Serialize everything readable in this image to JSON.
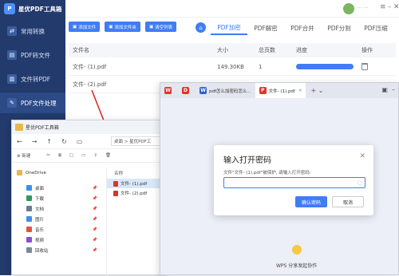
{
  "app": {
    "title": "星优PDF工具箱",
    "logo_text": "PDF",
    "sidebar_items": [
      {
        "label": "常用转换",
        "icon": "convert-icon"
      },
      {
        "label": "PDF转文件",
        "icon": "pdf-to-file-icon"
      },
      {
        "label": "文件转PDF",
        "icon": "file-to-pdf-icon"
      },
      {
        "label": "PDF文件处理",
        "icon": "pdf-process-icon"
      }
    ],
    "user_text": "··· ···",
    "buttons": [
      "添加文件",
      "添加文件夹",
      "清空列表"
    ],
    "tabs": [
      "PDF加密",
      "PDF解密",
      "PDF合并",
      "PDF分割",
      "PDF压缩"
    ],
    "active_tab": "PDF加密",
    "table": {
      "headers": [
        "文件名",
        "大小",
        "总页数",
        "进度",
        "操作"
      ],
      "rows": [
        {
          "name": "文件- (1).pdf",
          "size": "149.30KB",
          "pages": "1",
          "progress": 1.0
        },
        {
          "name": "文件- (2).pdf",
          "size": "",
          "pages": "",
          "progress": 0
        }
      ]
    },
    "accent_color": "#3f7df6"
  },
  "explorer": {
    "title": "星优PDF工具箱",
    "address": "桌面 > 星优PDF工",
    "new_label": "新建",
    "nav": [
      {
        "label": "OneDrive",
        "pinned": false
      },
      {
        "label": "桌面",
        "pinned": true
      },
      {
        "label": "下载",
        "pinned": true
      },
      {
        "label": "文档",
        "pinned": true
      },
      {
        "label": "图片",
        "pinned": true
      },
      {
        "label": "音乐",
        "pinned": true
      },
      {
        "label": "视频",
        "pinned": true
      },
      {
        "label": "回收站",
        "pinned": true
      }
    ],
    "column_header": "名称",
    "files": [
      "文件- (1).pdf",
      "文件- (2).pdf"
    ]
  },
  "wps": {
    "tabs": [
      {
        "label": "",
        "icon": "wps-icon"
      },
      {
        "label": "",
        "icon": "docer-icon"
      },
      {
        "label": "pdf怎么加密码怎么...",
        "icon": "word-doc-icon"
      },
      {
        "label": "文件- (1).pdf",
        "icon": "pdf-icon"
      }
    ],
    "dialog": {
      "title": "输入打开密码",
      "message": "文件\"文件- (1).pdf\"被保护, 请输入打开密码:",
      "confirm": "确认密码",
      "cancel": "取消"
    },
    "footer": "WPS 分享发起协作"
  }
}
